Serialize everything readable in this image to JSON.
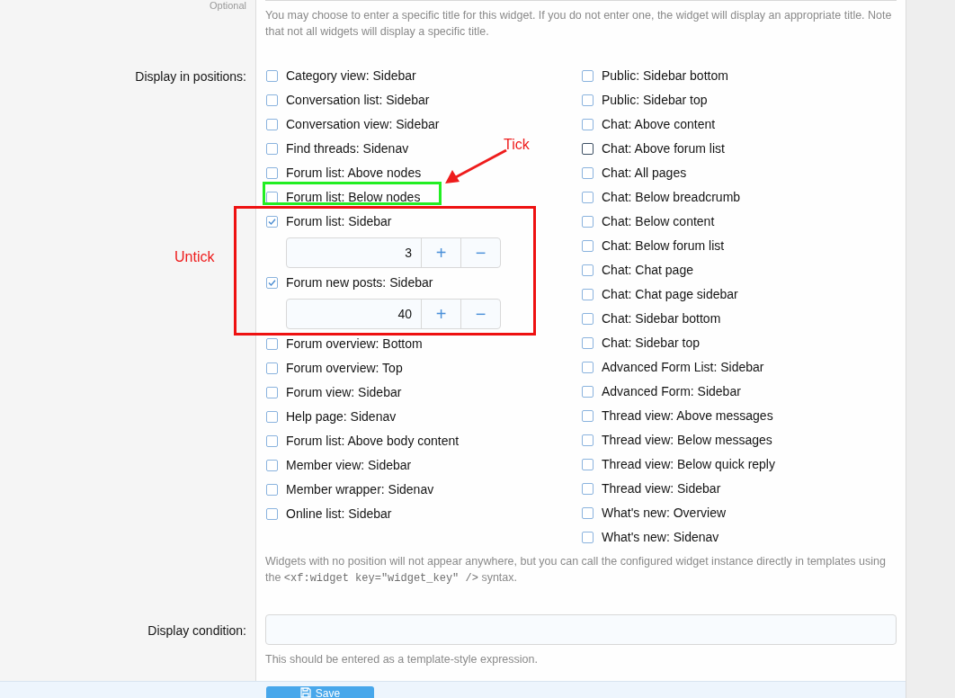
{
  "title_field": {
    "label": "Optional",
    "explain": "You may choose to enter a specific title for this widget. If you do not enter one, the widget will display an appropriate title. Note that not all widgets will display a specific title."
  },
  "positions": {
    "label": "Display in positions:",
    "columns": [
      [
        {
          "label": "Category view: Sidebar",
          "checked": false,
          "hovered": false
        },
        {
          "label": "Conversation list: Sidebar",
          "checked": false,
          "hovered": false
        },
        {
          "label": "Conversation view: Sidebar",
          "checked": false,
          "hovered": false
        },
        {
          "label": "Find threads: Sidenav",
          "checked": false,
          "hovered": false
        },
        {
          "label": "Forum list: Above nodes",
          "checked": false,
          "hovered": false
        },
        {
          "label": "Forum list: Below nodes",
          "checked": false,
          "hovered": false
        },
        {
          "label": "Forum list: Sidebar",
          "checked": true,
          "hovered": false,
          "order": {
            "value": "3",
            "plus": "+",
            "minus": "−"
          }
        },
        {
          "label": "Forum new posts: Sidebar",
          "checked": true,
          "hovered": false,
          "order": {
            "value": "40",
            "plus": "+",
            "minus": "−"
          }
        },
        {
          "label": "Forum overview: Bottom",
          "checked": false,
          "hovered": false
        },
        {
          "label": "Forum overview: Top",
          "checked": false,
          "hovered": false
        },
        {
          "label": "Forum view: Sidebar",
          "checked": false,
          "hovered": false
        },
        {
          "label": "Help page: Sidenav",
          "checked": false,
          "hovered": false
        },
        {
          "label": "Forum list: Above body content",
          "checked": false,
          "hovered": false
        },
        {
          "label": "Member view: Sidebar",
          "checked": false,
          "hovered": false
        },
        {
          "label": "Member wrapper: Sidenav",
          "checked": false,
          "hovered": false
        },
        {
          "label": "Online list: Sidebar",
          "checked": false,
          "hovered": false
        }
      ],
      [
        {
          "label": "Public: Sidebar bottom",
          "checked": false,
          "hovered": false
        },
        {
          "label": "Public: Sidebar top",
          "checked": false,
          "hovered": false
        },
        {
          "label": "Chat: Above content",
          "checked": false,
          "hovered": false
        },
        {
          "label": "Chat: Above forum list",
          "checked": false,
          "hovered": true
        },
        {
          "label": "Chat: All pages",
          "checked": false,
          "hovered": false
        },
        {
          "label": "Chat: Below breadcrumb",
          "checked": false,
          "hovered": false
        },
        {
          "label": "Chat: Below content",
          "checked": false,
          "hovered": false
        },
        {
          "label": "Chat: Below forum list",
          "checked": false,
          "hovered": false
        },
        {
          "label": "Chat: Chat page",
          "checked": false,
          "hovered": false
        },
        {
          "label": "Chat: Chat page sidebar",
          "checked": false,
          "hovered": false
        },
        {
          "label": "Chat: Sidebar bottom",
          "checked": false,
          "hovered": false
        },
        {
          "label": "Chat: Sidebar top",
          "checked": false,
          "hovered": false
        },
        {
          "label": "Advanced Form List: Sidebar",
          "checked": false,
          "hovered": false
        },
        {
          "label": "Advanced Form: Sidebar",
          "checked": false,
          "hovered": false
        },
        {
          "label": "Thread view: Above messages",
          "checked": false,
          "hovered": false
        },
        {
          "label": "Thread view: Below messages",
          "checked": false,
          "hovered": false
        },
        {
          "label": "Thread view: Below quick reply",
          "checked": false,
          "hovered": false
        },
        {
          "label": "Thread view: Sidebar",
          "checked": false,
          "hovered": false
        },
        {
          "label": "What's new: Overview",
          "checked": false,
          "hovered": false
        },
        {
          "label": "What's new: Sidenav",
          "checked": false,
          "hovered": false
        }
      ]
    ],
    "explain": {
      "before": "Widgets with no position will not appear anywhere, but you can call the configured widget instance directly in templates using the",
      "code": "<xf:widget key=\"widget_key\" />",
      "after": "syntax."
    }
  },
  "condition": {
    "label": "Display condition:",
    "explain": "This should be entered as a template-style expression."
  },
  "save_button": "Save",
  "annotations": [
    {
      "kind": "label",
      "text": "Tick",
      "color": "#ee1c1c"
    },
    {
      "kind": "arrow",
      "color": "#ee1c1c"
    },
    {
      "kind": "box",
      "color": "#22ee22"
    },
    {
      "kind": "box",
      "color": "#ee1111"
    },
    {
      "kind": "label",
      "text": "Untick",
      "color": "#ee1c1c"
    }
  ]
}
